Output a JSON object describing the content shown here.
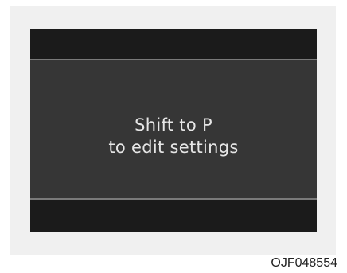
{
  "display": {
    "message_line1": "Shift to P",
    "message_line2": "to edit settings"
  },
  "figure_code": "OJF048554",
  "colors": {
    "screen_background": "#363636",
    "band_background": "#1b1b1b",
    "divider": "#7a7a7a",
    "frame": "#f0f0f0",
    "text": "#e6e6e6"
  }
}
